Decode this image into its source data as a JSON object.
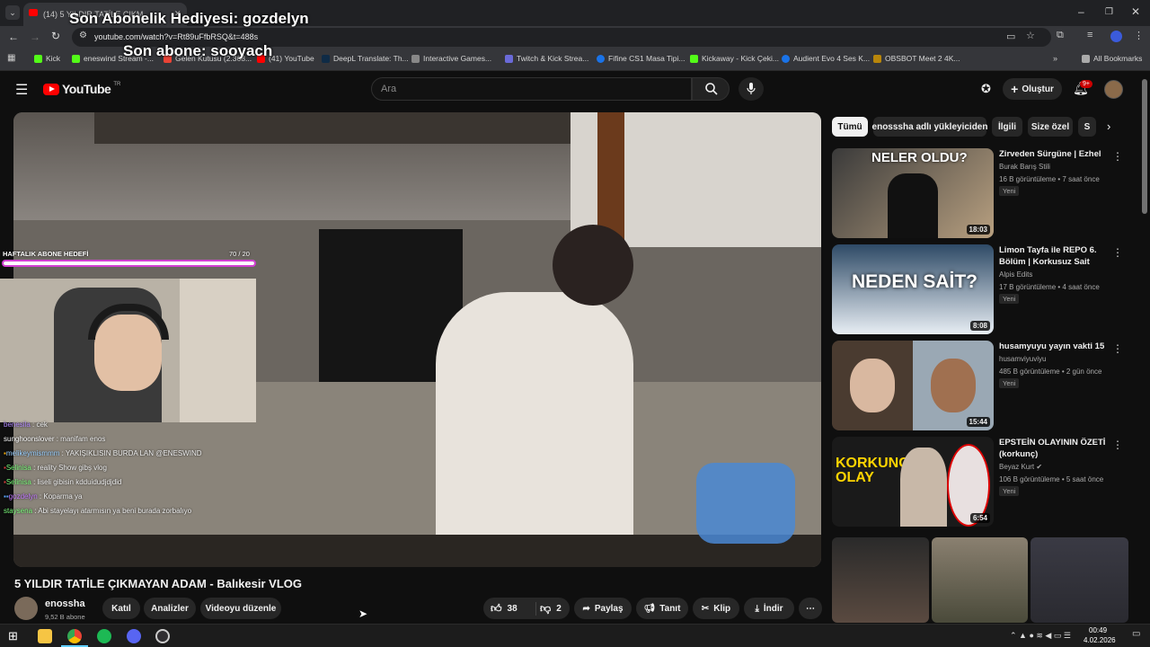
{
  "browser": {
    "tab_title": "(14) 5 YILDIR TATİLE ÇIKM",
    "url": "youtube.com/watch?v=Rt89uFfbRSQ&t=488s",
    "bookmarks": [
      "Kick",
      "eneswind Stream -...",
      "Gelen Kutusu (2.368...",
      "(41) YouTube",
      "DeepL Translate: Th...",
      "Interactive Games...",
      "Twitch & Kick Strea...",
      "Fifine CS1 Masa Tipi...",
      "Kickaway - Kick Çeki...",
      "Audient Evo 4 Ses K...",
      "OBSBOT Meet 2 4K..."
    ],
    "all_bookmarks": "All Bookmarks"
  },
  "overlay": {
    "gift_line": "Son Abonelik Hediyesi: gozdelyn",
    "sub_line": "Son abone: sooyach",
    "goal_label": "HAFTALIK ABONE HEDEFİ",
    "goal_value": "70 / 20",
    "goal_progress": 1.0
  },
  "chat": [
    {
      "user": "benesila",
      "msg": " : cek",
      "color": "#b58cff"
    },
    {
      "user": "sunghoonslover",
      "msg": " : manifam enos",
      "color": "#ffffff"
    },
    {
      "user": "melikeymismmm",
      "msg": " : YAKIŞIKLISIN BURDA LAN @ENESWIND",
      "color": "#9ad0ff"
    },
    {
      "user": "Selinisa",
      "msg": " : reality Show gibş vlog",
      "color": "#7dff7d"
    },
    {
      "user": "Selinisa",
      "msg": " : liseli gibisin kdduidudjdjdid",
      "color": "#7dff7d"
    },
    {
      "user": "gozdelyn",
      "msg": " : Koparma ya",
      "color": "#c47bff"
    },
    {
      "user": "staysena",
      "msg": " : Abi stayelayı atarmısın ya beni burada zorbalıyo",
      "color": "#7dff7d"
    }
  ],
  "youtube": {
    "logo": "YouTube",
    "logo_sup": "TR",
    "search_placeholder": "Ara",
    "create_label": "Oluştur",
    "notif_count": "9+"
  },
  "video": {
    "title": "5 YILDIR TATİLE ÇIKMAYAN ADAM - Balıkesir VLOG",
    "channel": "enossha",
    "subs": "9,52 B abone",
    "join": "Katıl",
    "analytics": "Analizler",
    "edit": "Videoyu düzenle",
    "likes": "38",
    "dislikes": "2",
    "share": "Paylaş",
    "promote": "Tanıt",
    "clip": "Klip",
    "download": "İndir"
  },
  "chips": [
    "Tümü",
    "enosssha adlı yükleyiciden",
    "İlgili",
    "Size özel",
    "S"
  ],
  "recommendations": [
    {
      "title": "Zirveden Sürgüne | Ezhel",
      "channel": "Burak Barış Stili",
      "meta": "16 B görüntüleme • 7 saat önce",
      "badge": "Yeni",
      "duration": "18:03",
      "thumb_text": "NELER OLDU?",
      "c1": "#3a3a3a",
      "c2": "#b8a080"
    },
    {
      "title": "Limon Tayfa ile REPO 6. Bölüm | Korkusuz Sait",
      "channel": "Alpis Edits",
      "meta": "17 B görüntüleme • 4 saat önce",
      "badge": "Yeni",
      "duration": "8:08",
      "thumb_text": "NEDEN SAİT?",
      "c1": "#2e4a66",
      "c2": "#e8eef4"
    },
    {
      "title": "husamyuyu yayın vakti 15",
      "channel": "husamviyuviyu",
      "meta": "485 B görüntüleme • 2 gün önce",
      "badge": "Yeni",
      "duration": "15:44",
      "thumb_text": "",
      "c1": "#4a3b30",
      "c2": "#9aa8b4"
    },
    {
      "title": "EPSTEİN OLAYININ ÖZETİ (korkunç)",
      "channel": "Beyaz Kurt",
      "meta": "106 B görüntüleme • 5 saat önce",
      "badge": "Yeni",
      "duration": "6:54",
      "thumb_text": "KORKUNÇ OLAY",
      "c1": "#1a1a1a",
      "c2": "#ffd400"
    }
  ],
  "taskbar": {
    "time": "00:49",
    "date": "4.02.2026"
  }
}
